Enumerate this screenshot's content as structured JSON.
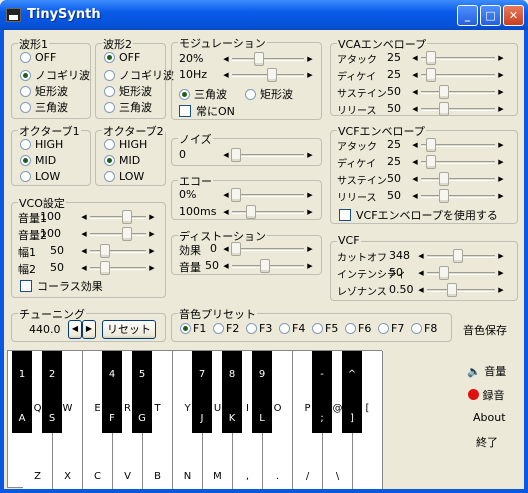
{
  "window": {
    "title": "TinySynth"
  },
  "wave1": {
    "title": "波形1",
    "options": [
      "OFF",
      "ノコギリ波",
      "矩形波",
      "三角波"
    ],
    "selected": 1
  },
  "wave2": {
    "title": "波形2",
    "options": [
      "OFF",
      "ノコギリ波",
      "矩形波",
      "三角波"
    ],
    "selected": 0
  },
  "oct1": {
    "title": "オクターブ1",
    "options": [
      "HIGH",
      "MID",
      "LOW"
    ],
    "selected": 1
  },
  "oct2": {
    "title": "オクターブ2",
    "options": [
      "HIGH",
      "MID",
      "LOW"
    ],
    "selected": 1
  },
  "vco": {
    "title": "VCO設定",
    "rows": [
      {
        "label": "音量1",
        "value": "100"
      },
      {
        "label": "音量2",
        "value": "100"
      },
      {
        "label": "幅1",
        "value": "50"
      },
      {
        "label": "幅2",
        "value": "50"
      }
    ],
    "chorus": "コーラス効果"
  },
  "mod": {
    "title": "モジュレーション",
    "depth": "20%",
    "rate": "10Hz",
    "wave_options": [
      "三角波",
      "矩形波"
    ],
    "selected": 0,
    "always_on": "常にON"
  },
  "noise": {
    "title": "ノイズ",
    "value": "0"
  },
  "echo": {
    "title": "エコー",
    "level": "0%",
    "time": "100ms"
  },
  "dist": {
    "title": "ディストーション",
    "effect_label": "効果",
    "effect_value": "0",
    "volume_label": "音量",
    "volume_value": "50"
  },
  "vca": {
    "title": "VCAエンベロープ",
    "rows": [
      {
        "label": "アタック",
        "value": "25"
      },
      {
        "label": "ディケイ",
        "value": "25"
      },
      {
        "label": "サステイン",
        "value": "50"
      },
      {
        "label": "リリース",
        "value": "50"
      }
    ]
  },
  "vcfenv": {
    "title": "VCFエンベロープ",
    "rows": [
      {
        "label": "アタック",
        "value": "25"
      },
      {
        "label": "ディケイ",
        "value": "25"
      },
      {
        "label": "サステイン",
        "value": "50"
      },
      {
        "label": "リリース",
        "value": "50"
      }
    ],
    "use": "VCFエンベロープを使用する"
  },
  "vcf": {
    "title": "VCF",
    "rows": [
      {
        "label": "カットオフ",
        "value": "348"
      },
      {
        "label": "インテンシティ",
        "value": "50"
      },
      {
        "label": "レゾナンス",
        "value": "0.50"
      }
    ]
  },
  "tuning": {
    "title": "チューニング",
    "value": "440.0",
    "reset": "リセット"
  },
  "presets": {
    "title": "音色プリセット",
    "options": [
      "F1",
      "F2",
      "F3",
      "F4",
      "F5",
      "F6",
      "F7",
      "F8"
    ],
    "selected": 0,
    "save": "音色保存"
  },
  "side": {
    "volume": "音量",
    "record": "録音",
    "about": "About",
    "exit": "終了"
  },
  "keys": {
    "white": [
      {
        "u": "Q",
        "l": "Z"
      },
      {
        "u": "W",
        "l": "X"
      },
      {
        "u": "E",
        "l": "C"
      },
      {
        "u": "R",
        "l": "V"
      },
      {
        "u": "T",
        "l": "B"
      },
      {
        "u": "Y",
        "l": "N"
      },
      {
        "u": "U",
        "l": "M"
      },
      {
        "u": "I",
        "l": ","
      },
      {
        "u": "O",
        "l": "."
      },
      {
        "u": "P",
        "l": "/"
      },
      {
        "u": "@",
        "l": "\\"
      },
      {
        "u": "[",
        "l": ""
      }
    ],
    "black": [
      {
        "u": "1",
        "l": "A"
      },
      {
        "u": "2",
        "l": "S"
      },
      {
        "u": "4",
        "l": "F"
      },
      {
        "u": "5",
        "l": "G"
      },
      {
        "u": "7",
        "l": "J"
      },
      {
        "u": "8",
        "l": "K"
      },
      {
        "u": "9",
        "l": "L"
      },
      {
        "u": "-",
        "l": ";"
      },
      {
        "u": "^",
        "l": "]"
      }
    ]
  },
  "colors": {
    "titlebar": "#0a5bea",
    "face": "#ece9d8",
    "record": "#e01010"
  }
}
